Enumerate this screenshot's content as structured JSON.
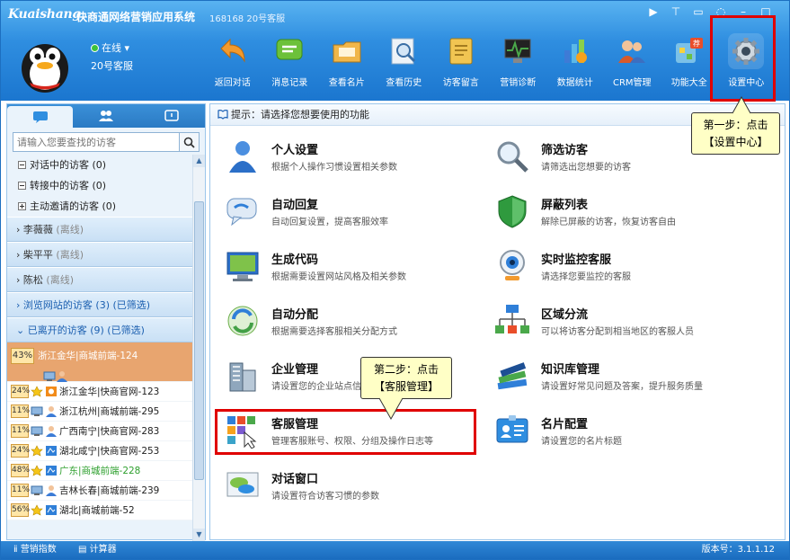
{
  "app": {
    "logo": "Kuaishang",
    "title": "快商通网络营销应用系统",
    "session": "168168 20号客服",
    "status": "在线",
    "username": "20号客服"
  },
  "window_controls": [
    "▶|",
    "👕",
    "□",
    "◎",
    "_",
    "□"
  ],
  "toolbar": [
    {
      "label": "返回对话",
      "icon": "back-arrow-icon",
      "color": "#f29a2e"
    },
    {
      "label": "消息记录",
      "icon": "message-icon",
      "color": "#6cc13a"
    },
    {
      "label": "查看名片",
      "icon": "folder-card-icon",
      "color": "#f0b64a"
    },
    {
      "label": "查看历史",
      "icon": "history-search-icon",
      "color": "#8aa9c8"
    },
    {
      "label": "访客留言",
      "icon": "note-icon",
      "color": "#f1c552"
    },
    {
      "label": "营销诊断",
      "icon": "diagnosis-icon",
      "color": "#4aa84a"
    },
    {
      "label": "数据统计",
      "icon": "statistics-icon",
      "color": "#3e7bd6"
    },
    {
      "label": "CRM管理",
      "icon": "crm-users-icon",
      "color": "#d85a2a"
    },
    {
      "label": "功能大全",
      "icon": "features-icon",
      "color": "#7bc1e8"
    },
    {
      "label": "设置中心",
      "icon": "gear-icon",
      "color": "#cfd8e0"
    }
  ],
  "sidebar": {
    "search_placeholder": "请输入您要查找的访客",
    "sub_items": [
      {
        "label": "对话中的访客 (0)",
        "box": "minus"
      },
      {
        "label": "转接中的访客 (0)",
        "box": "minus"
      },
      {
        "label": "主动邀请的访客 (0)",
        "box": "plus"
      }
    ],
    "groups": [
      {
        "label": "李薇薇",
        "note": "(离线)"
      },
      {
        "label": "柴平平",
        "note": "(离线)"
      },
      {
        "label": "陈松",
        "note": "(离线)"
      },
      {
        "label": "浏览网站的访客 (3) (已筛选)",
        "note": ""
      }
    ],
    "expanded_group": "已离开的访客 (9) (已筛选)",
    "visitors": [
      {
        "pct": "43%",
        "text": "浙江金华|商城前端-124",
        "style": "sel"
      },
      {
        "pct": "24%",
        "text": "浙江金华|快商官网-123",
        "style": "normal"
      },
      {
        "pct": "11%",
        "text": "浙江杭州|商城前端-295",
        "style": "normal"
      },
      {
        "pct": "11%",
        "text": "广西南宁|快商官网-283",
        "style": "normal"
      },
      {
        "pct": "24%",
        "text": "湖北咸宁|快商官网-253",
        "style": "normal"
      },
      {
        "pct": "48%",
        "text": "广东|商城前端-228",
        "style": "green"
      },
      {
        "pct": "11%",
        "text": "吉林长春|商城前端-239",
        "style": "normal"
      },
      {
        "pct": "56%",
        "text": "湖北|商城前端-52",
        "style": "normal"
      }
    ]
  },
  "main": {
    "hint": "提示：请选择您想要使用的功能",
    "functions": [
      {
        "title": "个人设置",
        "desc": "根据个人操作习惯设置相关参数",
        "icon": "person-icon"
      },
      {
        "title": "筛选访客",
        "desc": "请筛选出您想要的访客",
        "icon": "magnifier-icon"
      },
      {
        "title": "自动回复",
        "desc": "自动回复设置，提高客服效率",
        "icon": "speech-bubble-icon"
      },
      {
        "title": "屏蔽列表",
        "desc": "解除已屏蔽的访客，恢复访客自由",
        "icon": "shield-icon"
      },
      {
        "title": "生成代码",
        "desc": "根据需要设置网站风格及相关参数",
        "icon": "monitor-code-icon"
      },
      {
        "title": "实时监控客服",
        "desc": "请选择您要监控的客服",
        "icon": "webcam-icon"
      },
      {
        "title": "自动分配",
        "desc": "根据需要选择客服相关分配方式",
        "icon": "refresh-distribute-icon"
      },
      {
        "title": "区域分流",
        "desc": "可以将访客分配到相当地区的客服人员",
        "icon": "network-icon"
      },
      {
        "title": "企业管理",
        "desc": "请设置您的企业站点信",
        "icon": "building-icon"
      },
      {
        "title": "知识库管理",
        "desc": "请设置好常见问题及答案，提升服务质量",
        "icon": "books-icon"
      },
      {
        "title": "客服管理",
        "desc": "管理客服账号、权限、分组及操作日志等",
        "icon": "agent-grid-icon"
      },
      {
        "title": "名片配置",
        "desc": "请设置您的名片标题",
        "icon": "id-card-icon"
      },
      {
        "title": "对话窗口",
        "desc": "请设置符合访客习惯的参数",
        "icon": "chat-window-icon"
      }
    ]
  },
  "callouts": {
    "step1_line1": "第一步：点击",
    "step1_line2": "【设置中心】",
    "step2_line1": "第二步：点击",
    "step2_line2": "【客服管理】"
  },
  "statusbar": {
    "marketing_index": "营销指数",
    "calculator": "计算器",
    "version": "版本号：3.1.1.12"
  },
  "colors": {
    "banner_top": "#59b3f1",
    "banner_bottom": "#1b76cf",
    "highlight_red": "#e00000",
    "callout_bg": "#ffffc6",
    "selected_row": "#e8a56f"
  }
}
